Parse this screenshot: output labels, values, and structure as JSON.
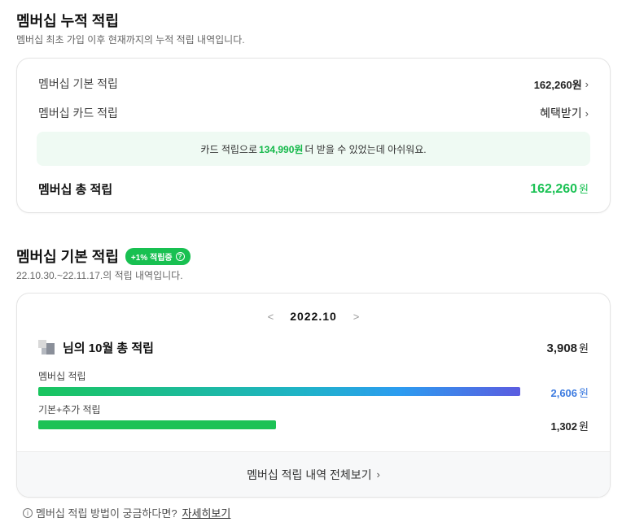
{
  "cumulative": {
    "title": "멤버십 누적 적립",
    "subtitle": "멤버십 최초 가입 이후 현재까지의 누적 적립 내역입니다.",
    "basic_label": "멤버십 기본 적립",
    "basic_value": "162,260원",
    "card_label": "멤버십 카드 적립",
    "card_value": "혜택받기",
    "notice_prefix": "카드 적립으로",
    "notice_amount": "134,990원",
    "notice_suffix": "더 받을 수 있었는데 아쉬워요.",
    "total_label": "멤버십 총 적립",
    "total_value": "162,260",
    "total_unit": "원"
  },
  "basic": {
    "title": "멤버십 기본 적립",
    "badge": "+1% 적립중",
    "badge_icon": "?",
    "period": "22.10.30.~22.11.17.의 적립 내역입니다.",
    "month_label": "2022.10",
    "prev_icon": "<",
    "next_icon": ">",
    "user_summary": "님의 10월 총 적립",
    "user_total": "3,908",
    "user_total_unit": "원",
    "bars": [
      {
        "label": "멤버십 적립",
        "value": "2,606",
        "unit": "원",
        "fraction": 0.87
      },
      {
        "label": "기본+추가 적립",
        "value": "1,302",
        "unit": "원",
        "fraction": 0.43
      }
    ],
    "view_all": "멤버십 적립 내역 전체보기"
  },
  "help": {
    "text": "멤버십 적립 방법이 궁금하다면?",
    "link": "자세히보기"
  },
  "colors": {
    "green": "#1cc255",
    "blue": "#3d7be0",
    "gradient_start": "#19c55e",
    "gradient_end": "#5b5ce0"
  }
}
